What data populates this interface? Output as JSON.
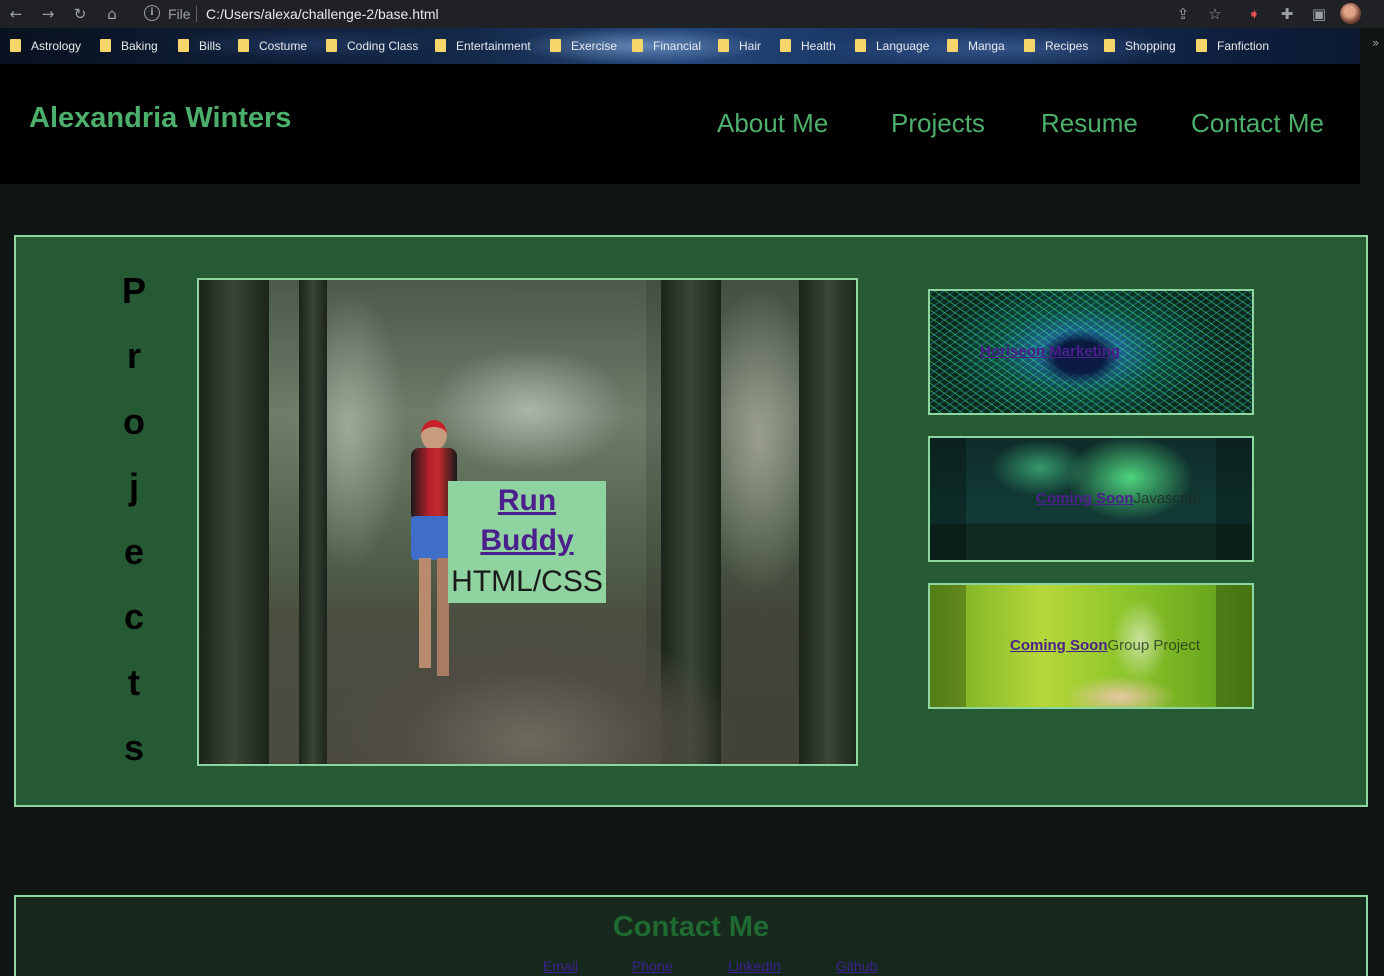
{
  "browser": {
    "url_scheme": "File",
    "url": "C:/Users/alexa/challenge-2/base.html",
    "nav_icons": [
      "back-icon",
      "forward-icon",
      "reload-icon",
      "home-icon"
    ],
    "toolbar_icons": [
      "share-icon",
      "star-icon",
      "extension-icon",
      "puzzle-icon",
      "sidebar-icon"
    ],
    "bookmarks": [
      "Astrology",
      "Baking",
      "Bills",
      "Costume",
      "Coding Class",
      "Entertainment",
      "Exercise",
      "Financial",
      "Hair",
      "Health",
      "Language",
      "Manga",
      "Recipes",
      "Shopping",
      "Fanfiction"
    ],
    "bookmarks_more": "»"
  },
  "site": {
    "name": "Alexandria Winters",
    "nav": [
      "About Me",
      "Projects",
      "Resume",
      "Contact Me"
    ]
  },
  "projects": {
    "heading_letters": [
      "P",
      "r",
      "o",
      "j",
      "e",
      "c",
      "t",
      "s"
    ],
    "feature": {
      "title": "Run Buddy",
      "subtitle": "HTML/CSS"
    },
    "cards": [
      {
        "title": "Horiseon Marketing",
        "subtitle": ""
      },
      {
        "title": "Coming Soon",
        "subtitle": "Javascript"
      },
      {
        "title": "Coming Soon",
        "subtitle": "Group Project"
      }
    ]
  },
  "contact": {
    "title": "Contact Me",
    "links": [
      "Email",
      "Phone",
      "LinkedIn",
      "Github"
    ]
  },
  "colors": {
    "accent_green": "#4caf6c",
    "section_green": "#265a35",
    "border_green": "#8ed6a0",
    "link_purple": "#4b1f8c"
  }
}
